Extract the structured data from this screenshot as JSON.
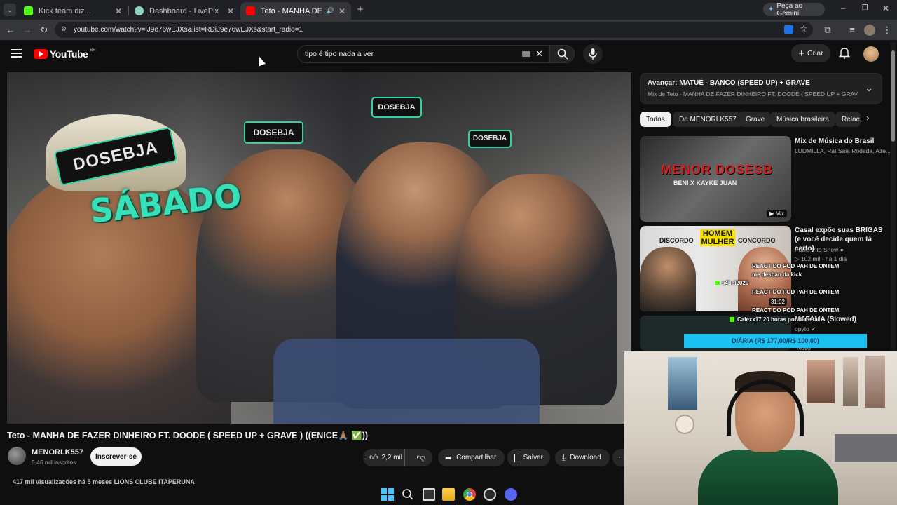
{
  "browser": {
    "tabs": [
      {
        "title": "Kick team diz...",
        "active": false
      },
      {
        "title": "Dashboard - LivePix",
        "active": false
      },
      {
        "title": "Teto - MANHA DE FAZER D",
        "active": true
      }
    ],
    "gemini_label": "Peça ao Gemini",
    "url": "youtube.com/watch?v=iJ9e76wEJXs&list=RDiJ9e76wEJXs&start_radio=1"
  },
  "header": {
    "logo_text": "YouTube",
    "region": "BR",
    "search_value": "tipo é tipo nada a ver",
    "create_label": "Criar"
  },
  "player": {
    "overlay_text": "SÁBADO",
    "glasses_text": "DOSEBJA"
  },
  "video": {
    "title": "Teto - MANHA DE FAZER DINHEIRO FT. DOODE ( SPEED UP + GRAVE ) ((ENICE🙏🏽 ✅))",
    "channel": "MENORLK557",
    "subscribers": "5,46 mil inscritos",
    "subscribe_label": "Inscrever-se",
    "likes": "2,2 mil",
    "share_label": "Compartilhar",
    "save_label": "Salvar",
    "download_label": "Download",
    "views_line": "417 mil visualizações  há 5 meses  LIONS CLUBE ITAPERUNA"
  },
  "up_next": {
    "title": "Avançar: MATUÊ - BANCO (SPEED UP) + GRAVE",
    "subtitle": "Mix de Teto - MANHA DE FAZER DINHEIRO FT. DOODE ( SPEED UP + GRAVE ) ((ENI..."
  },
  "chips": [
    "Todos",
    "De MENORLK557",
    "Grave",
    "Música brasileira",
    "Relac"
  ],
  "recommendations": [
    {
      "title": "Mix de Música do Brasil",
      "meta": "LUDMILLA, Raí Saia Rodada, Aze...",
      "badge": "Mix",
      "thumb_text_1": "MENOR DOSESB",
      "thumb_text_2": "BENI X KAYKE JUAN"
    },
    {
      "title": "Casal expõe suas BRIGAS (e você decide quem tá certo)",
      "channel": "Paulo Vita Show",
      "meta": "102 mil · há 1 dia",
      "duration": "31:02",
      "thumb_left": "DISCORDO",
      "thumb_mid": "HOMEM MULHER",
      "thumb_right": "CONCORDO"
    },
    {
      "title": "MAFAMA (Slowed)",
      "channel": "opyto",
      "meta": "Novo"
    }
  ],
  "stream_overlay": {
    "chat": [
      "REACT DO POD PAH DE ONTEM",
      "me desban da kick",
      "s4bel2020",
      "REACT DO POD PAH DE ONTEM",
      "REACT DO POD PAH DE ONTEM",
      "Caiexx17  20 horas por dia e tal"
    ],
    "goal_label": "DIÁRIA (R$ 177,00/R$ 100,00)",
    "goal_color": "#19c2ef"
  },
  "colors": {
    "youtube_red": "#ff0000",
    "bg": "#0f0f0f"
  }
}
